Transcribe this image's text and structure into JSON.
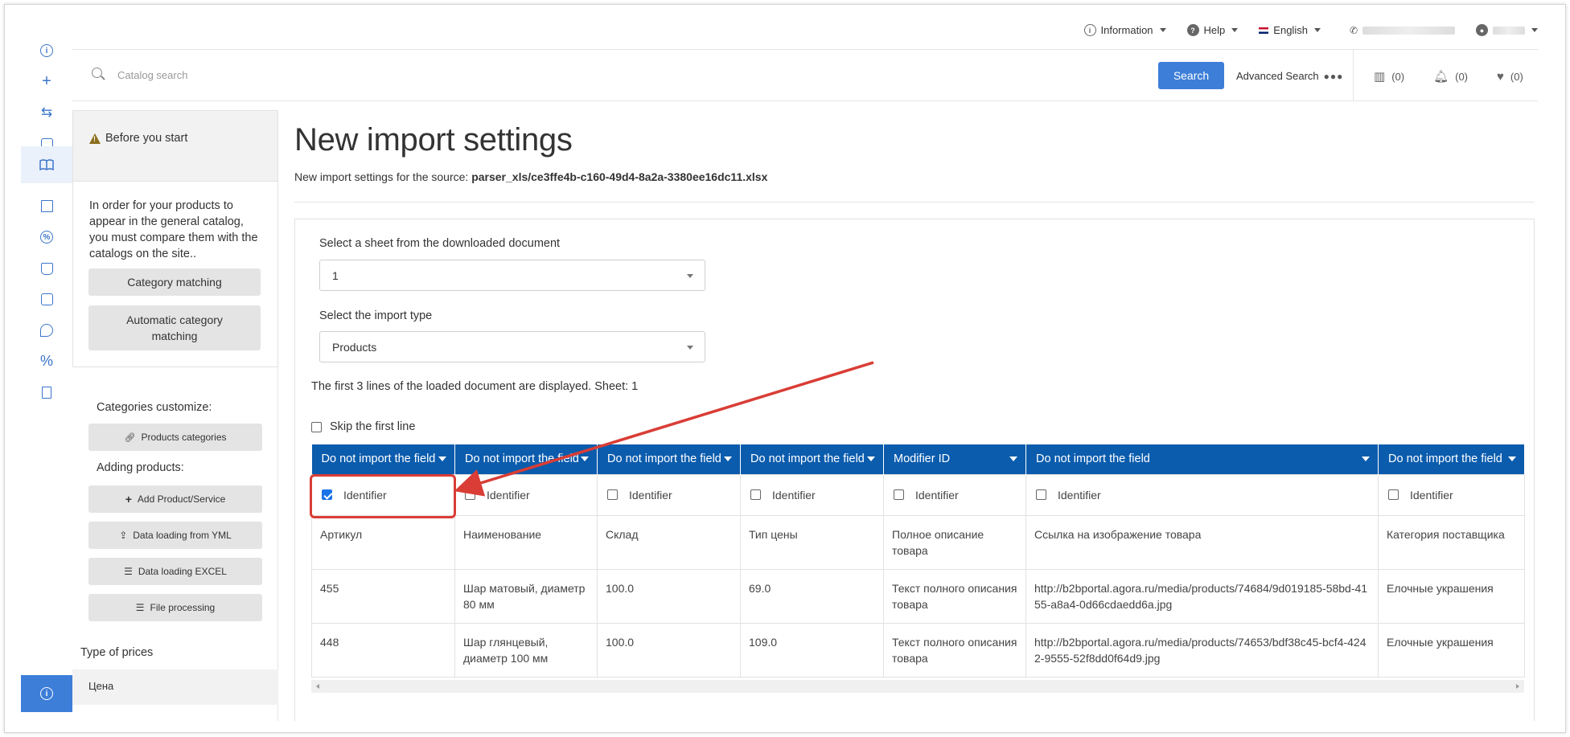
{
  "topbar": {
    "information": "Information",
    "help": "Help",
    "language": "English"
  },
  "search": {
    "placeholder": "Catalog search",
    "button": "Search",
    "advanced": "Advanced Search",
    "compare_count": "(0)",
    "notifications_count": "(0)",
    "favorites_count": "(0)"
  },
  "sidebar_rail": {
    "icons": [
      "info-icon",
      "plus-icon",
      "exchange-icon",
      "book-edit-icon",
      "catalog-book-icon",
      "document-list-icon",
      "percent-circle-icon",
      "bag-icon",
      "newspaper-icon",
      "chat-icon",
      "percent-icon",
      "file-icon"
    ],
    "active_index": 4,
    "bottom_icon": "info-icon"
  },
  "left_panel": {
    "before_title": "Before you start",
    "before_text": "In order for your products to appear in the general catalog, you must compare them with the catalogs on the site..",
    "category_matching": "Category matching",
    "automatic_category_matching": "Automatic category matching",
    "categories_customize": "Categories customize:",
    "products_categories": "Products categories",
    "adding_products": "Adding products:",
    "add_product": "Add Product/Service",
    "yml_loading": "Data loading from YML",
    "excel_loading": "Data loading EXCEL",
    "file_processing": "File processing",
    "type_of_prices": "Type of prices",
    "price_item": "Цена"
  },
  "main": {
    "title": "New import settings",
    "subtitle_prefix": "New import settings for the source:",
    "source_file": "parser_xls/ce3ffe4b-c160-49d4-8a2a-3380ee16dc11.xlsx",
    "sheet_label": "Select a sheet from the downloaded document",
    "sheet_value": "1",
    "type_label": "Select the import type",
    "type_value": "Products",
    "lines_note": "The first 3 lines of the loaded document are displayed. Sheet: 1",
    "skip_first_line": "Skip the first line"
  },
  "table": {
    "headers": [
      "Do not import the field",
      "Do not import the field",
      "Do not import the field",
      "Do not import the field",
      "Modifier ID",
      "Do not import the field",
      "Do not import the field"
    ],
    "identifier_label": "Identifier",
    "identifier_checked": [
      true,
      false,
      false,
      false,
      false,
      false,
      false
    ],
    "rows": [
      [
        "Артикул",
        "Наименование",
        "Склад",
        "Тип цены",
        "Полное описание товара",
        "Ссылка на изображение товара",
        "Категория поставщика"
      ],
      [
        "455",
        "Шар матовый, диаметр 80 мм",
        "100.0",
        "69.0",
        "Текст полного описания товара",
        "http://b2bportal.agora.ru/media/products/74684/9d019185-58bd-4155-a8a4-0d66cdaedd6a.jpg",
        "Елочные украшения"
      ],
      [
        "448",
        "Шар глянцевый, диаметр 100 мм",
        "100.0",
        "109.0",
        "Текст полного описания товара",
        "http://b2bportal.agora.ru/media/products/74653/bdf38c45-bcf4-4242-9555-52f8dd0f64d9.jpg",
        "Елочные украшения"
      ]
    ]
  },
  "colors": {
    "accent": "#3d7ed8",
    "table_header": "#0b5cad",
    "annotation": "#d93d35"
  }
}
